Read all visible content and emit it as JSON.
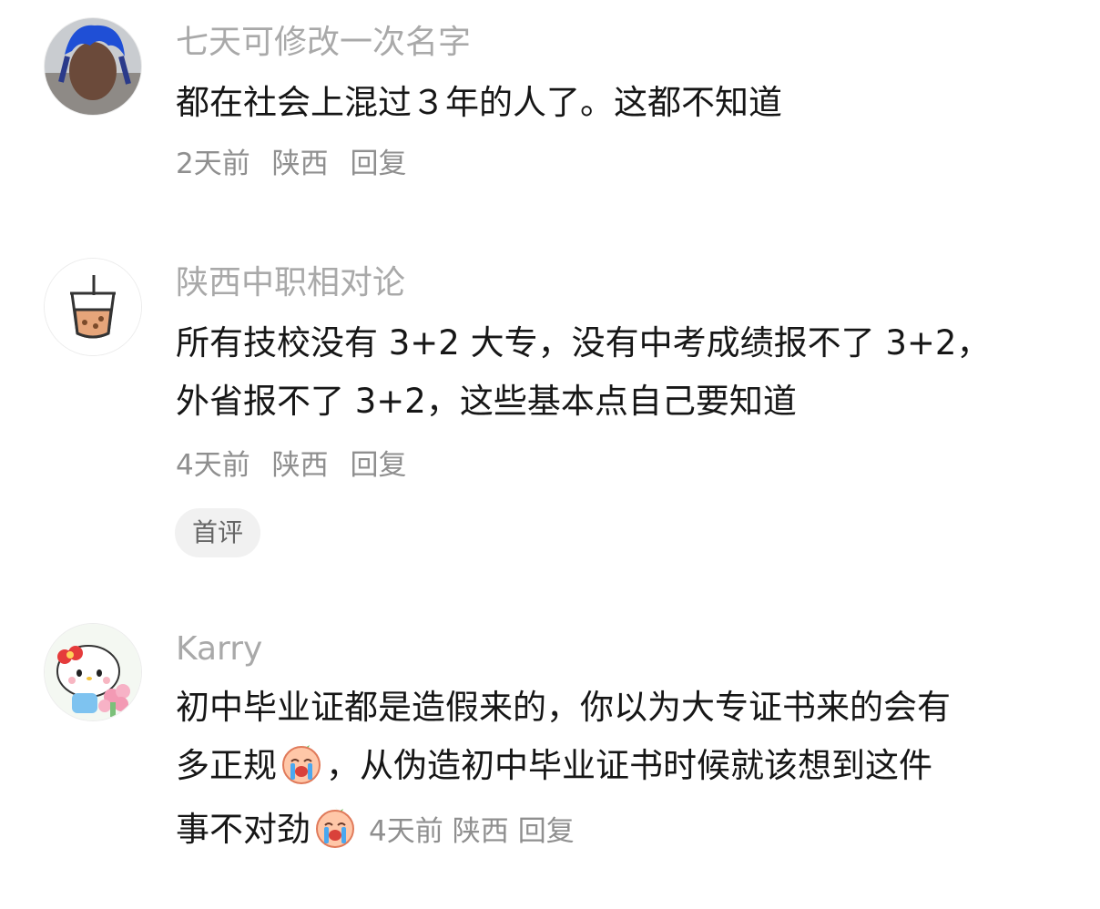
{
  "comments": [
    {
      "user": "七天可修改一次名字",
      "text": "都在社会上混过３年的人了。这都不知道",
      "time": "2天前",
      "location": "陕西",
      "reply": "回复"
    },
    {
      "user": "陕西中职相对论",
      "text_line1": "所有技校没有 3+2 大专，没有中考成绩报不了 3+2，",
      "text_line2": "外省报不了 3+2，这些基本点自己要知道",
      "time": "4天前",
      "location": "陕西",
      "reply": "回复",
      "badge": "首评"
    },
    {
      "user": "Karry",
      "text_line1": "初中毕业证都是造假来的，你以为大专证书来的会有",
      "text_line2a": "多正规",
      "text_line2b": "，从伪造初中毕业证书时候就该想到这件",
      "text_line3": "事不对劲",
      "time": "4天前",
      "location": "陕西",
      "reply": "回复",
      "emoji": "crying-emoji"
    }
  ]
}
